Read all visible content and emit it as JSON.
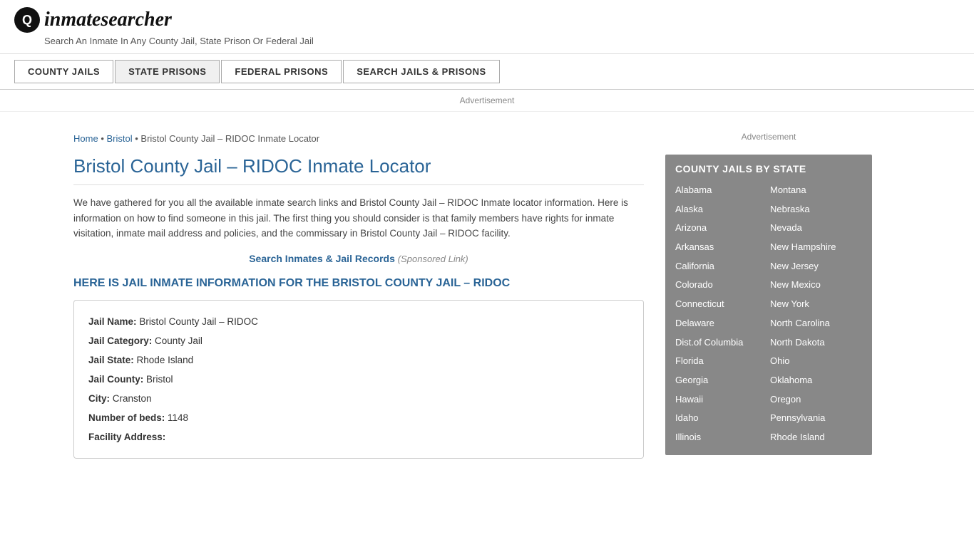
{
  "header": {
    "logo_icon": "Q",
    "logo_text_part1": "inmate",
    "logo_text_part2": "searcher",
    "tagline": "Search An Inmate In Any County Jail, State Prison Or Federal Jail"
  },
  "nav": {
    "items": [
      {
        "label": "COUNTY JAILS",
        "active": false
      },
      {
        "label": "STATE PRISONS",
        "active": true
      },
      {
        "label": "FEDERAL PRISONS",
        "active": false
      },
      {
        "label": "SEARCH JAILS & PRISONS",
        "active": false
      }
    ]
  },
  "breadcrumb": {
    "home": "Home",
    "second": "Bristol",
    "current": "Bristol County Jail – RIDOC Inmate Locator"
  },
  "page": {
    "title": "Bristol County Jail – RIDOC Inmate Locator",
    "body_text": "We have gathered for you all the available inmate search links and Bristol County Jail – RIDOC Inmate locator information. Here is information on how to find someone in this jail. The first thing you should consider is that family members have rights for inmate visitation, inmate mail address and policies, and the commissary in Bristol County Jail – RIDOC facility.",
    "sponsored_link_text": "Search Inmates & Jail Records",
    "sponsored_label": "(Sponsored Link)",
    "section_heading": "HERE IS JAIL INMATE INFORMATION FOR THE BRISTOL COUNTY JAIL – RIDOC",
    "advertisement_label": "Advertisement"
  },
  "jail_info": {
    "jail_name_label": "Jail Name:",
    "jail_name_value": "Bristol County Jail – RIDOC",
    "jail_category_label": "Jail Category:",
    "jail_category_value": "County Jail",
    "jail_state_label": "Jail State:",
    "jail_state_value": "Rhode Island",
    "jail_county_label": "Jail County:",
    "jail_county_value": "Bristol",
    "city_label": "City:",
    "city_value": "Cranston",
    "beds_label": "Number of beds:",
    "beds_value": "1148",
    "address_label": "Facility Address:"
  },
  "sidebar": {
    "advertisement_label": "Advertisement",
    "county_jails_heading": "COUNTY JAILS BY STATE",
    "states_left": [
      "Alabama",
      "Alaska",
      "Arizona",
      "Arkansas",
      "California",
      "Colorado",
      "Connecticut",
      "Delaware",
      "Dist.of Columbia",
      "Florida",
      "Georgia",
      "Hawaii",
      "Idaho",
      "Illinois"
    ],
    "states_right": [
      "Montana",
      "Nebraska",
      "Nevada",
      "New Hampshire",
      "New Jersey",
      "New Mexico",
      "New York",
      "North Carolina",
      "North Dakota",
      "Ohio",
      "Oklahoma",
      "Oregon",
      "Pennsylvania",
      "Rhode Island"
    ]
  }
}
